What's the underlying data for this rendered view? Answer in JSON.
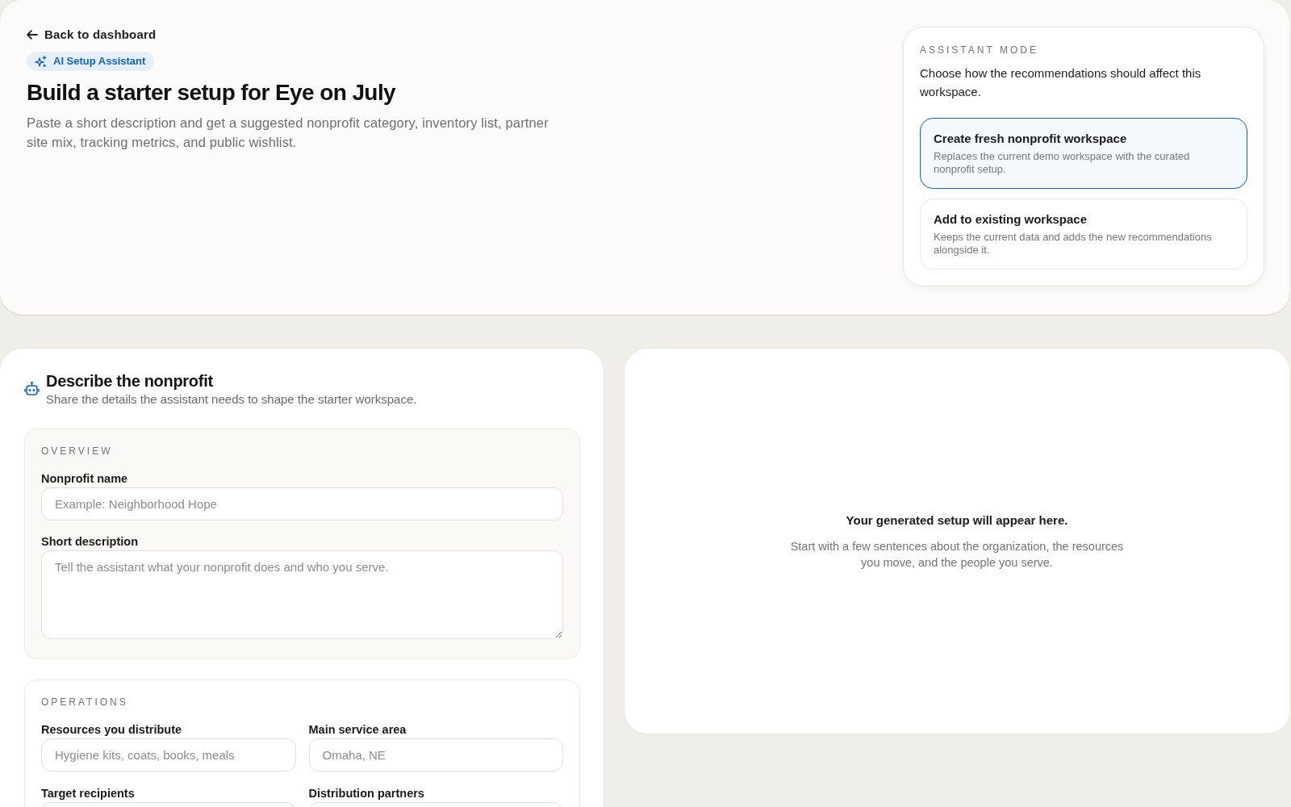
{
  "back_link": {
    "label": "Back to dashboard"
  },
  "badge": {
    "label": "AI Setup Assistant"
  },
  "title": "Build a starter setup for Eye on July",
  "description": "Paste a short description and get a suggested nonprofit category, inventory list, partner site mix, tracking metrics, and public wishlist.",
  "assistant_mode": {
    "heading": "ASSISTANT MODE",
    "prompt": "Choose how the recommendations should affect this workspace.",
    "options": [
      {
        "title": "Create fresh nonprofit workspace",
        "description": "Replaces the current demo workspace with the curated nonprofit setup.",
        "selected": true
      },
      {
        "title": "Add to existing workspace",
        "description": "Keeps the current data and adds the new recommendations alongside it.",
        "selected": false
      }
    ]
  },
  "form": {
    "title": "Describe the nonprofit",
    "subtitle": "Share the details the assistant needs to shape the starter workspace.",
    "sections": [
      {
        "heading": "OVERVIEW",
        "kind": "stack",
        "fields": [
          {
            "label": "Nonprofit name",
            "kind": "input",
            "placeholder": "Example: Neighborhood Hope"
          },
          {
            "label": "Short description",
            "kind": "textarea",
            "placeholder": "Tell the assistant what your nonprofit does and who you serve."
          }
        ]
      },
      {
        "heading": "OPERATIONS",
        "kind": "grid",
        "fields": [
          {
            "label": "Resources you distribute",
            "kind": "input",
            "placeholder": "Hygiene kits, coats, books, meals"
          },
          {
            "label": "Main service area",
            "kind": "input",
            "placeholder": "Omaha, NE"
          },
          {
            "label": "Target recipients",
            "kind": "input"
          },
          {
            "label": "Distribution partners",
            "kind": "input"
          }
        ]
      }
    ]
  },
  "preview": {
    "title": "Your generated setup will appear here.",
    "message": "Start with a few sentences about the organization, the resources you move, and the people you serve."
  }
}
